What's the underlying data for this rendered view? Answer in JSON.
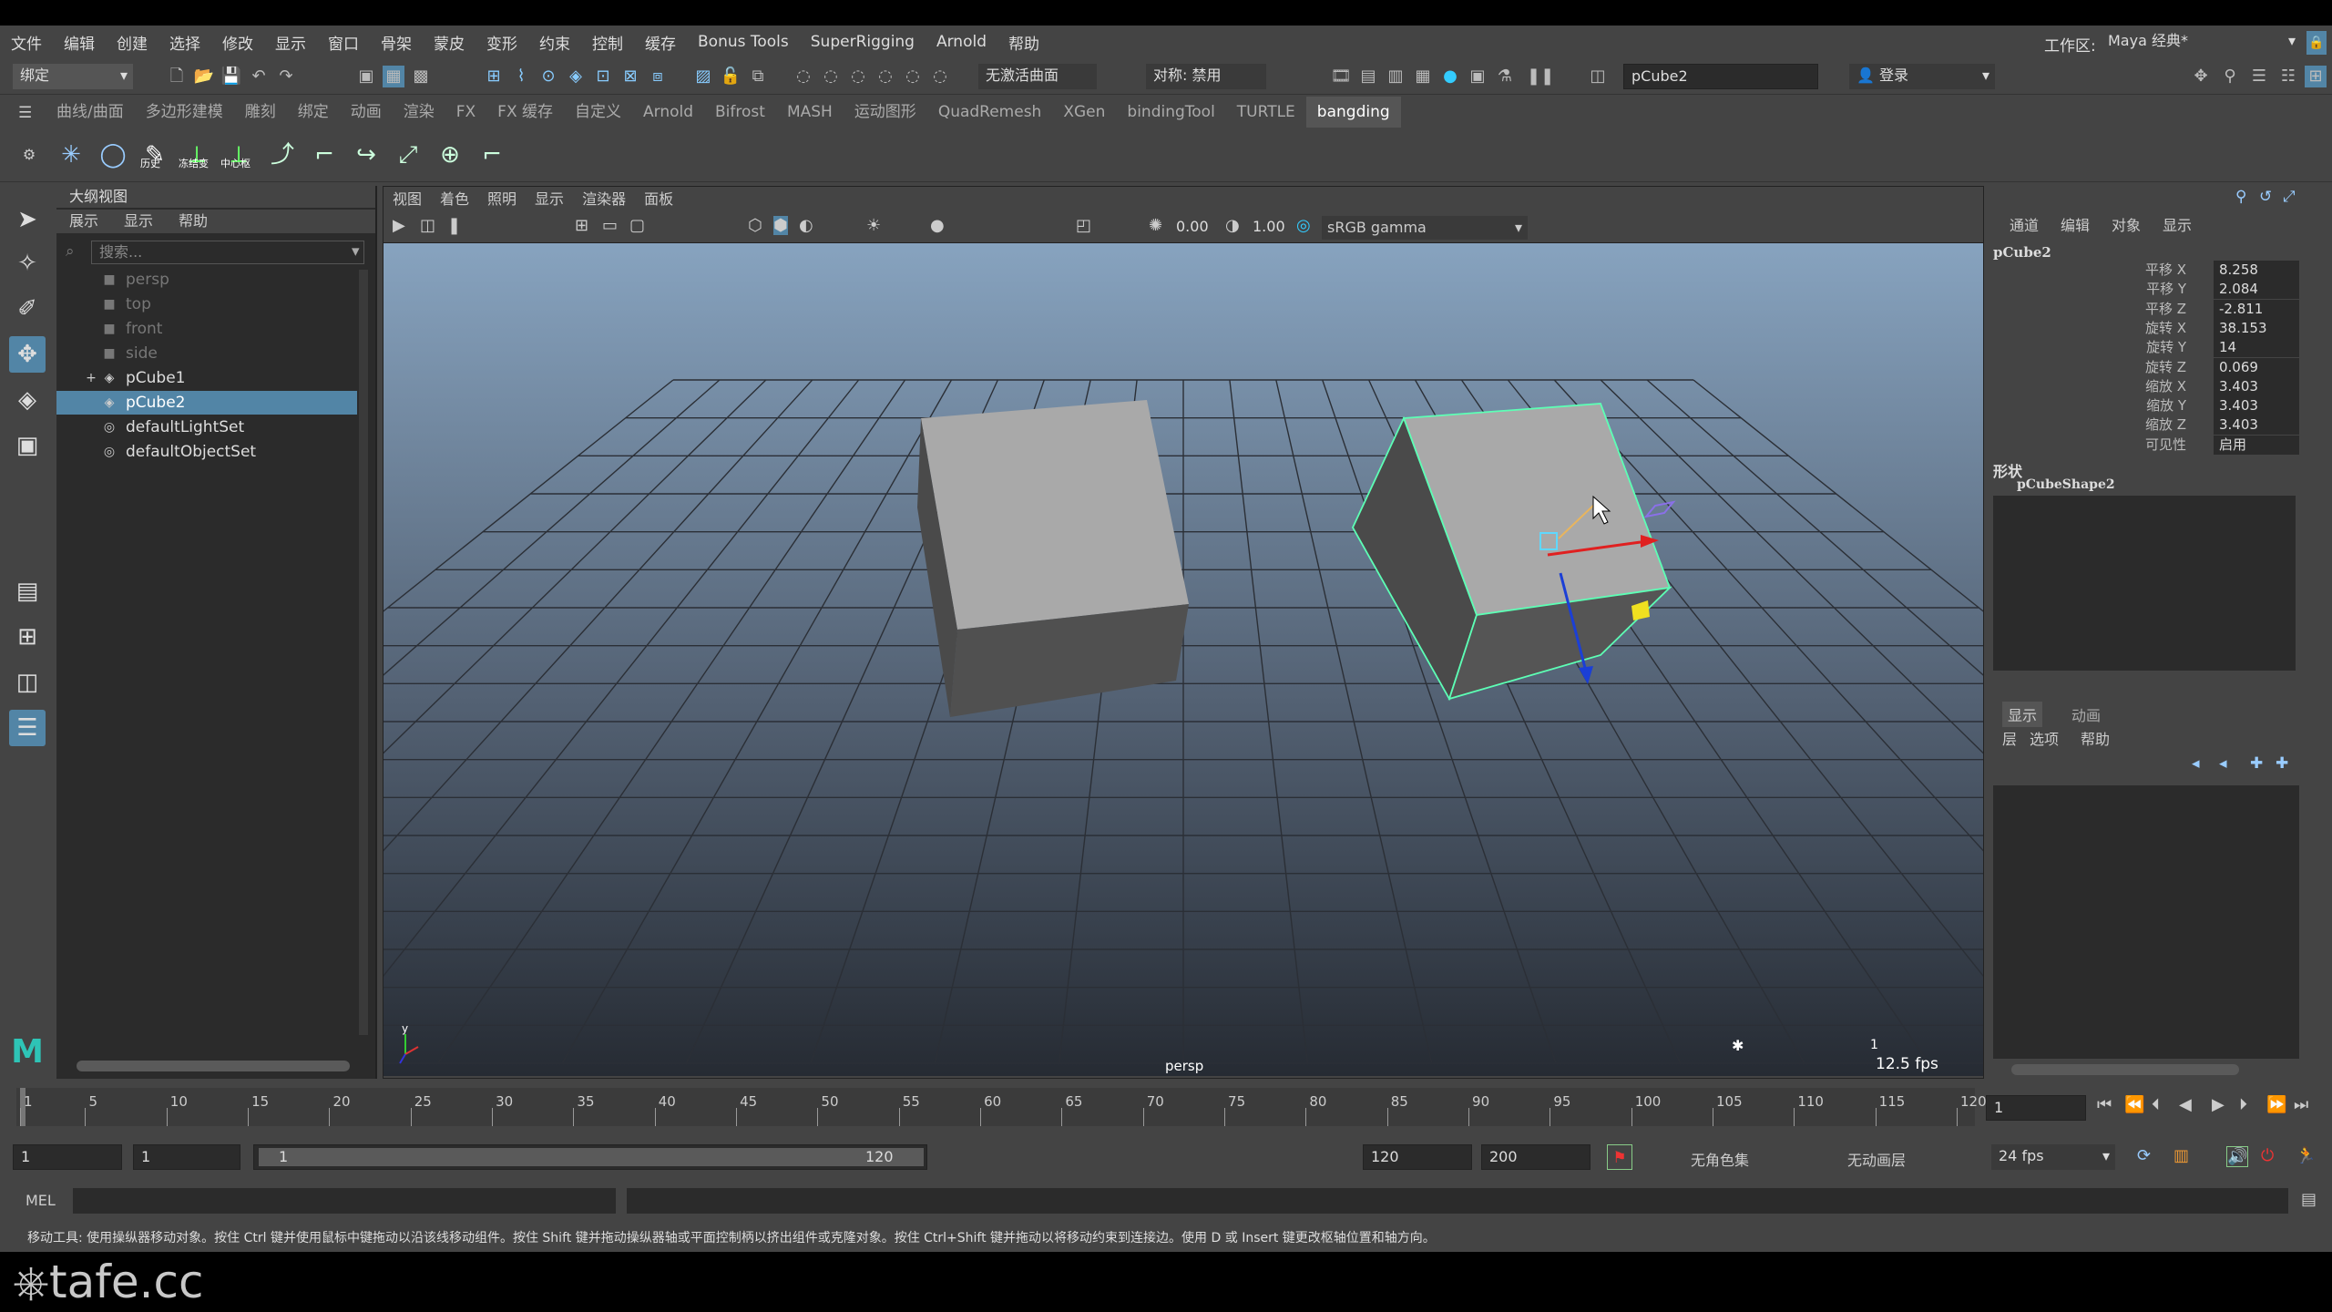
{
  "menu": [
    "文件",
    "编辑",
    "创建",
    "选择",
    "修改",
    "显示",
    "窗口",
    "骨架",
    "蒙皮",
    "变形",
    "约束",
    "控制",
    "缓存",
    "Bonus Tools",
    "SuperRigging",
    "Arnold",
    "帮助"
  ],
  "workspace": {
    "label": "工作区:",
    "value": "Maya 经典*"
  },
  "status": {
    "mode": "绑定",
    "snap_surface": "无激活曲面",
    "symmetry": "对称: 禁用",
    "object_name": "pCube2",
    "login": "登录"
  },
  "shelf_tabs": [
    "曲线/曲面",
    "多边形建模",
    "雕刻",
    "绑定",
    "动画",
    "渲染",
    "FX",
    "FX 缓存",
    "自定义",
    "Arnold",
    "Bifrost",
    "MASH",
    "运动图形",
    "QuadRemesh",
    "XGen",
    "bindingTool",
    "TURTLE",
    "bangding"
  ],
  "shelf_active": "bangding",
  "shelf_labels": [
    "历史",
    "冻结变",
    "中心枢"
  ],
  "outliner": {
    "title": "大纲视图",
    "menu": [
      "展示",
      "显示",
      "帮助"
    ],
    "search_placeholder": "搜索...",
    "items": [
      {
        "label": "persp",
        "icon": "camera-icon",
        "dim": true
      },
      {
        "label": "top",
        "icon": "camera-icon",
        "dim": true
      },
      {
        "label": "front",
        "icon": "camera-icon",
        "dim": true
      },
      {
        "label": "side",
        "icon": "camera-icon",
        "dim": true
      },
      {
        "label": "pCube1",
        "icon": "mesh-icon",
        "dim": false,
        "expand": "+"
      },
      {
        "label": "pCube2",
        "icon": "mesh-icon",
        "dim": false,
        "selected": true
      },
      {
        "label": "defaultLightSet",
        "icon": "set-icon",
        "dim": false
      },
      {
        "label": "defaultObjectSet",
        "icon": "set-icon",
        "dim": false
      }
    ]
  },
  "viewport": {
    "menu": [
      "视图",
      "着色",
      "照明",
      "显示",
      "渲染器",
      "面板"
    ],
    "exposure": "0.00",
    "gamma": "1.00",
    "colorspace": "sRGB gamma",
    "camera_label": "persp",
    "fps": "12.5 fps",
    "frame_count": "1"
  },
  "channel_box": {
    "menu": [
      "通道",
      "编辑",
      "对象",
      "显示"
    ],
    "object": "pCube2",
    "channels": [
      {
        "k": "平移 X",
        "v": "8.258"
      },
      {
        "k": "平移 Y",
        "v": "2.084"
      },
      {
        "k": "平移 Z",
        "v": "-2.811"
      },
      {
        "k": "旋转 X",
        "v": "38.153"
      },
      {
        "k": "旋转 Y",
        "v": "14"
      },
      {
        "k": "旋转 Z",
        "v": "0.069"
      },
      {
        "k": "缩放 X",
        "v": "3.403"
      },
      {
        "k": "缩放 Y",
        "v": "3.403"
      },
      {
        "k": "缩放 Z",
        "v": "3.403"
      },
      {
        "k": "可见性",
        "v": "启用"
      }
    ],
    "shapes_label": "形状",
    "shape": "pCubeShape2"
  },
  "layer_editor": {
    "tabs": [
      "显示",
      "动画"
    ],
    "menu": [
      "层",
      "选项",
      "帮助"
    ]
  },
  "timeline": {
    "ticks": [
      "1",
      "5",
      "10",
      "15",
      "20",
      "25",
      "30",
      "35",
      "40",
      "45",
      "50",
      "55",
      "60",
      "65",
      "70",
      "75",
      "80",
      "85",
      "90",
      "95",
      "100",
      "105",
      "110",
      "115",
      "120"
    ],
    "current": "1"
  },
  "range": {
    "start": "1",
    "play_start": "1",
    "slider_start": "1",
    "slider_end": "120",
    "play_end": "120",
    "end": "200",
    "character": "无角色集",
    "anim_layer": "无动画层",
    "fps": "24 fps"
  },
  "cmd": {
    "label": "MEL"
  },
  "help_text": "移动工具: 使用操纵器移动对象。按住 Ctrl 键并使用鼠标中键拖动以沿该线移动组件。按住 Shift 键并拖动操纵器轴或平面控制柄以挤出组件或克隆对象。按住 Ctrl+Shift 键并拖动以将移动约束到连接边。使用 D 或 Insert 键更改枢轴位置和轴方向。",
  "watermark": "tafe.cc",
  "colors": {
    "selection": "#5285a6",
    "panel": "#444444",
    "dark": "#2b2b2b",
    "wire_select": "#5dffb5"
  }
}
